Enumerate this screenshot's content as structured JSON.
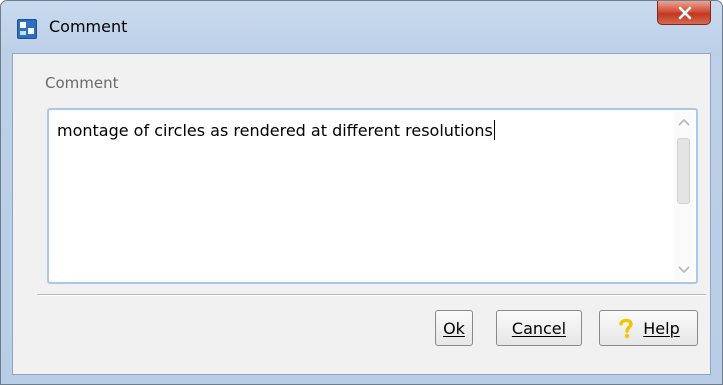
{
  "window": {
    "title": "Comment",
    "app_icon": "dialog-app-icon",
    "close_icon": "close-icon"
  },
  "form": {
    "field_label": "Comment",
    "textarea_value": "montage of circles as rendered at different resolutions"
  },
  "buttons": {
    "ok_label": "Ok",
    "cancel_label": "Cancel",
    "help_label": "Help",
    "help_icon": "question-mark-icon"
  },
  "colors": {
    "title_bar": "#c9daee",
    "close_button": "#c23720",
    "focus_border": "#a9c7e8",
    "help_icon": "#f5c400"
  }
}
